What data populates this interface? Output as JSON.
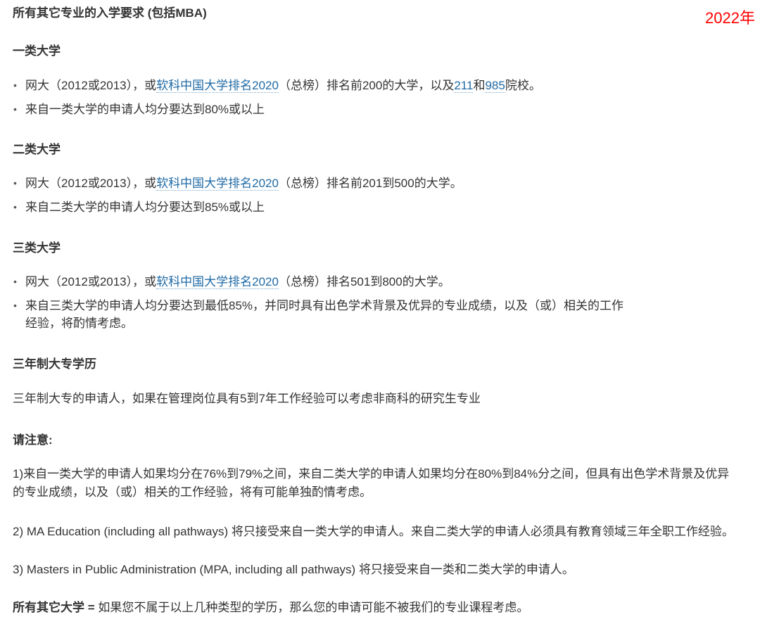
{
  "year_stamp": "2022年",
  "title": "所有其它专业的入学要求 (包括MBA)",
  "tier1": {
    "heading": "一类大学",
    "b1_pre": "网大（2012或2013），或",
    "b1_link": "软科中国大学排名2020",
    "b1_mid": "（总榜）排名前200的大学，以及",
    "b1_link2": "211",
    "b1_and": "和",
    "b1_link3": "985",
    "b1_post": "院校。",
    "b2": "来自一类大学的申请人均分要达到80%或以上"
  },
  "tier2": {
    "heading": "二类大学",
    "b1_pre": "网大（2012或2013），或",
    "b1_link": "软科中国大学排名2020",
    "b1_post": "（总榜）排名前201到500的大学。",
    "b2": "来自二类大学的申请人均分要达到85%或以上"
  },
  "tier3": {
    "heading": "三类大学",
    "b1_pre": "网大（2012或2013），或",
    "b1_link": "软科中国大学排名2020",
    "b1_post": "（总榜）排名501到800的大学。",
    "b2_line1": "来自三类大学的申请人均分要达到最低85%，并同时具有出色学术背景及优异的专业成绩，以及（或）相关的工作",
    "b2_line2": "经验，将酌情考虑。"
  },
  "diploma": {
    "heading": "三年制大专学历",
    "text": "三年制大专的申请人，如果在管理岗位具有5到7年工作经验可以考虑非商科的研究生专业"
  },
  "notes": {
    "heading": "请注意:",
    "n1_line1": "1)来自一类大学的申请人如果均分在76%到79%之间，来自二类大学的申请人如果均分在80%到84%分之间，但具有出色学术背景及优异",
    "n1_line2": "的专业成绩，以及（或）相关的工作经验，将有可能单独酌情考虑。",
    "n2": "2) MA Education (including all pathways) 将只接受来自一类大学的申请人。来自二类大学的申请人必须具有教育领域三年全职工作经验。",
    "n3": "3) Masters in Public Administration (MPA, including all pathways) 将只接受来自一类和二类大学的申请人。"
  },
  "footer": {
    "bold": "所有其它大学 =",
    "text": " 如果您不属于以上几种类型的学历，那么您的申请可能不被我们的专业课程考虑。"
  },
  "bullet_glyph": "•"
}
